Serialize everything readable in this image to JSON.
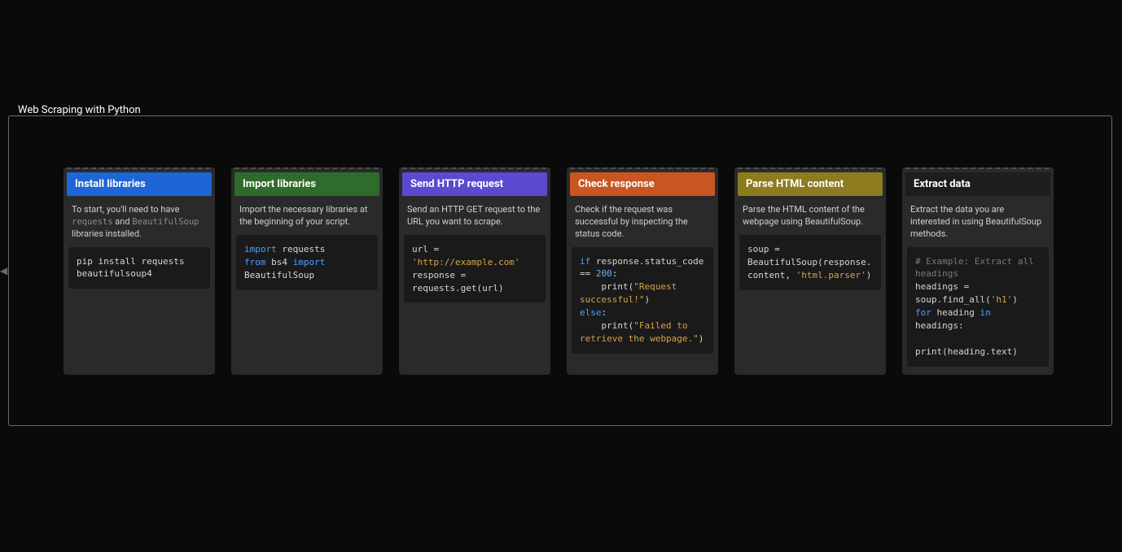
{
  "page": {
    "title": "Web Scraping with Python"
  },
  "cards": [
    {
      "title": "Install libraries",
      "header_class": "hdr-blue",
      "desc_segments": [
        {
          "text": "To start, you'll need to have ",
          "cls": ""
        },
        {
          "text": "requests",
          "cls": "inline-code"
        },
        {
          "text": " and ",
          "cls": ""
        },
        {
          "text": "BeautifulSoup",
          "cls": "inline-code"
        },
        {
          "text": " libraries installed.",
          "cls": ""
        }
      ],
      "code": [
        {
          "text": "pip install requests beautifulsoup4",
          "cls": "tok-pln"
        }
      ]
    },
    {
      "title": "Import libraries",
      "header_class": "hdr-green",
      "desc_segments": [
        {
          "text": "Import the necessary libraries at the beginning of your script.",
          "cls": ""
        }
      ],
      "code": [
        {
          "text": "import",
          "cls": "tok-kw"
        },
        {
          "text": " requests\n",
          "cls": "tok-pln"
        },
        {
          "text": "from",
          "cls": "tok-kw"
        },
        {
          "text": " bs4 ",
          "cls": "tok-pln"
        },
        {
          "text": "import",
          "cls": "tok-kw"
        },
        {
          "text": " BeautifulSoup",
          "cls": "tok-pln"
        }
      ]
    },
    {
      "title": "Send HTTP request",
      "header_class": "hdr-purple",
      "desc_segments": [
        {
          "text": "Send an HTTP GET request to the URL you want to scrape.",
          "cls": ""
        }
      ],
      "code": [
        {
          "text": "url = ",
          "cls": "tok-pln"
        },
        {
          "text": "'http://example.com'",
          "cls": "tok-str"
        },
        {
          "text": "\nresponse = requests.get(url)",
          "cls": "tok-pln"
        }
      ]
    },
    {
      "title": "Check response",
      "header_class": "hdr-orange",
      "desc_segments": [
        {
          "text": "Check if the request was successful by inspecting the status code.",
          "cls": ""
        }
      ],
      "code": [
        {
          "text": "if",
          "cls": "tok-kw"
        },
        {
          "text": " response.status_code == ",
          "cls": "tok-pln"
        },
        {
          "text": "200",
          "cls": "tok-num"
        },
        {
          "text": ":\n    print(",
          "cls": "tok-pln"
        },
        {
          "text": "\"Request successful!\"",
          "cls": "tok-str"
        },
        {
          "text": ")\n",
          "cls": "tok-pln"
        },
        {
          "text": "else",
          "cls": "tok-kw"
        },
        {
          "text": ":\n    print(",
          "cls": "tok-pln"
        },
        {
          "text": "\"Failed to retrieve the webpage.\"",
          "cls": "tok-str"
        },
        {
          "text": ")",
          "cls": "tok-pln"
        }
      ]
    },
    {
      "title": "Parse HTML content",
      "header_class": "hdr-olive",
      "desc_segments": [
        {
          "text": "Parse the HTML content of the webpage using BeautifulSoup.",
          "cls": ""
        }
      ],
      "code": [
        {
          "text": "soup = BeautifulSoup(response.content, ",
          "cls": "tok-pln"
        },
        {
          "text": "'html.parser'",
          "cls": "tok-str"
        },
        {
          "text": ")",
          "cls": "tok-pln"
        }
      ]
    },
    {
      "title": "Extract data",
      "header_class": "hdr-dark",
      "desc_segments": [
        {
          "text": "Extract the data you are interested in using BeautifulSoup methods.",
          "cls": ""
        }
      ],
      "code": [
        {
          "text": "# Example: Extract all headings",
          "cls": "tok-com"
        },
        {
          "text": "\nheadings = soup.find_all(",
          "cls": "tok-pln"
        },
        {
          "text": "'h1'",
          "cls": "tok-str"
        },
        {
          "text": ")\n",
          "cls": "tok-pln"
        },
        {
          "text": "for",
          "cls": "tok-kw"
        },
        {
          "text": " heading ",
          "cls": "tok-pln"
        },
        {
          "text": "in",
          "cls": "tok-kw"
        },
        {
          "text": " headings:\n\nprint(heading.text)",
          "cls": "tok-pln"
        }
      ]
    }
  ]
}
